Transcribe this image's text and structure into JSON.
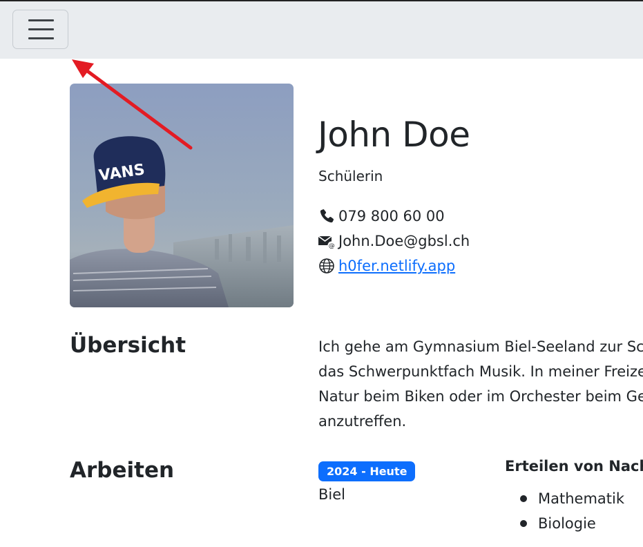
{
  "navbar": {
    "toggle_icon": "hamburger-menu-icon",
    "background": "#e9ecef"
  },
  "annotation": {
    "arrow_color": "#e31b23"
  },
  "profile": {
    "name": "John Doe",
    "role": "Schülerin",
    "phone": "079 800 60 00",
    "email": "John.Doe@gbsl.ch",
    "website": "h0fer.netlify.app",
    "photo_cap_text": "VANS"
  },
  "overview": {
    "title": "Übersicht",
    "lines": [
      "Ich gehe am Gymnasium Biel-Seeland zur Sch",
      "das Schwerpunktfach Musik. In meiner Freize",
      "Natur beim Biken oder im Orchester beim Ge",
      "anzutreffen."
    ]
  },
  "work": {
    "title": "Arbeiten",
    "badge": "2024 - Heute",
    "place": "Biel",
    "job_title": "Erteilen von Nachh",
    "subjects": [
      "Mathematik",
      "Biologie"
    ]
  },
  "colors": {
    "link": "#0d6efd",
    "badge": "#0d6efd",
    "text": "#212529"
  }
}
